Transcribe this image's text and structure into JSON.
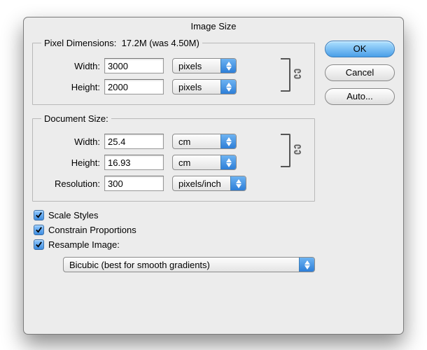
{
  "window": {
    "title": "Image Size"
  },
  "pixel": {
    "legend": "Pixel Dimensions:",
    "summary": "17.2M (was 4.50M)",
    "width_label": "Width:",
    "width_value": "3000",
    "height_label": "Height:",
    "height_value": "2000",
    "unit_width": "pixels",
    "unit_height": "pixels"
  },
  "doc": {
    "legend": "Document Size:",
    "width_label": "Width:",
    "width_value": "25.4",
    "height_label": "Height:",
    "height_value": "16.93",
    "unit_width": "cm",
    "unit_height": "cm",
    "res_label": "Resolution:",
    "res_value": "300",
    "res_unit": "pixels/inch"
  },
  "checks": {
    "scale": "Scale Styles",
    "constrain": "Constrain Proportions",
    "resample": "Resample Image:"
  },
  "resample_method": "Bicubic (best for smooth gradients)",
  "buttons": {
    "ok": "OK",
    "cancel": "Cancel",
    "auto": "Auto..."
  },
  "chain_icon": "chain-link"
}
